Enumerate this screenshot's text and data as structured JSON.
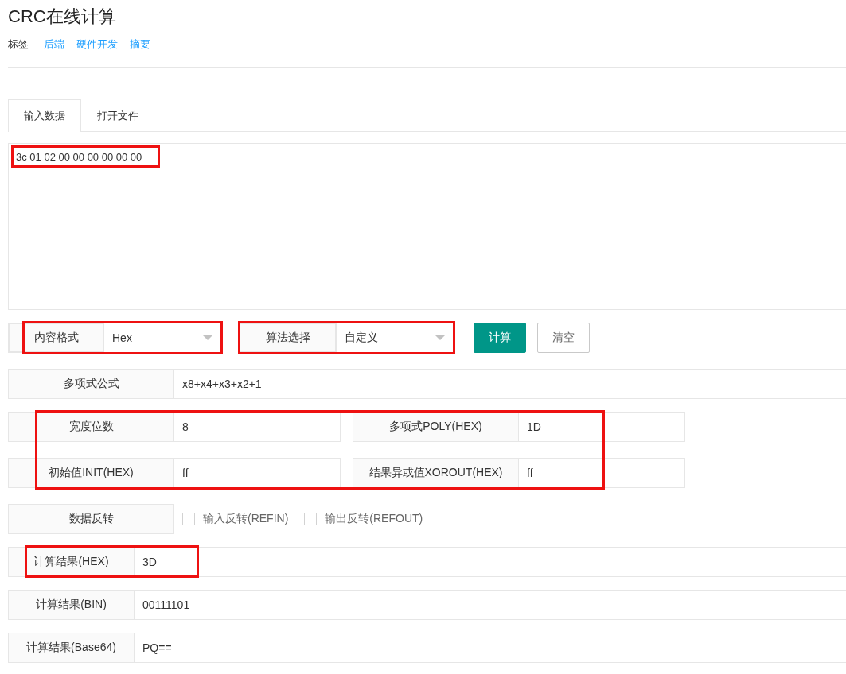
{
  "title": "CRC在线计算",
  "tags": {
    "label": "标签",
    "items": [
      "后端",
      "硬件开发",
      "摘要"
    ]
  },
  "tabs": [
    {
      "label": "输入数据",
      "selected": true
    },
    {
      "label": "打开文件",
      "selected": false
    }
  ],
  "input": {
    "value": "3c 01 02 00 00 00 00 00 00",
    "highlighted": true
  },
  "selects": [
    {
      "label": "内容格式",
      "value": "Hex",
      "highlighted": true
    },
    {
      "label": "算法选择",
      "value": "自定义",
      "highlighted": true
    }
  ],
  "buttons": [
    {
      "label": "计算",
      "kind": "primary"
    },
    {
      "label": "清空",
      "kind": "default"
    }
  ],
  "formula": {
    "label": "多项式公式",
    "value": "x8+x4+x3+x2+1"
  },
  "params": {
    "highlighted": true,
    "fields": [
      {
        "label": "宽度位数",
        "value": "8"
      },
      {
        "label": "多项式POLY(HEX)",
        "value": "1D"
      },
      {
        "label": "初始值INIT(HEX)",
        "value": "ff"
      },
      {
        "label": "结果异或值XOROUT(HEX)",
        "value": "ff"
      }
    ]
  },
  "reverse": {
    "label": "数据反转",
    "options": [
      {
        "label": "输入反转(REFIN)",
        "checked": false
      },
      {
        "label": "输出反转(REFOUT)",
        "checked": false
      }
    ]
  },
  "results": [
    {
      "label": "计算结果(HEX)",
      "value": "3D",
      "highlighted": true
    },
    {
      "label": "计算结果(BIN)",
      "value": "00111101",
      "highlighted": false
    },
    {
      "label": "计算结果(Base64)",
      "value": "PQ==",
      "highlighted": false
    }
  ]
}
